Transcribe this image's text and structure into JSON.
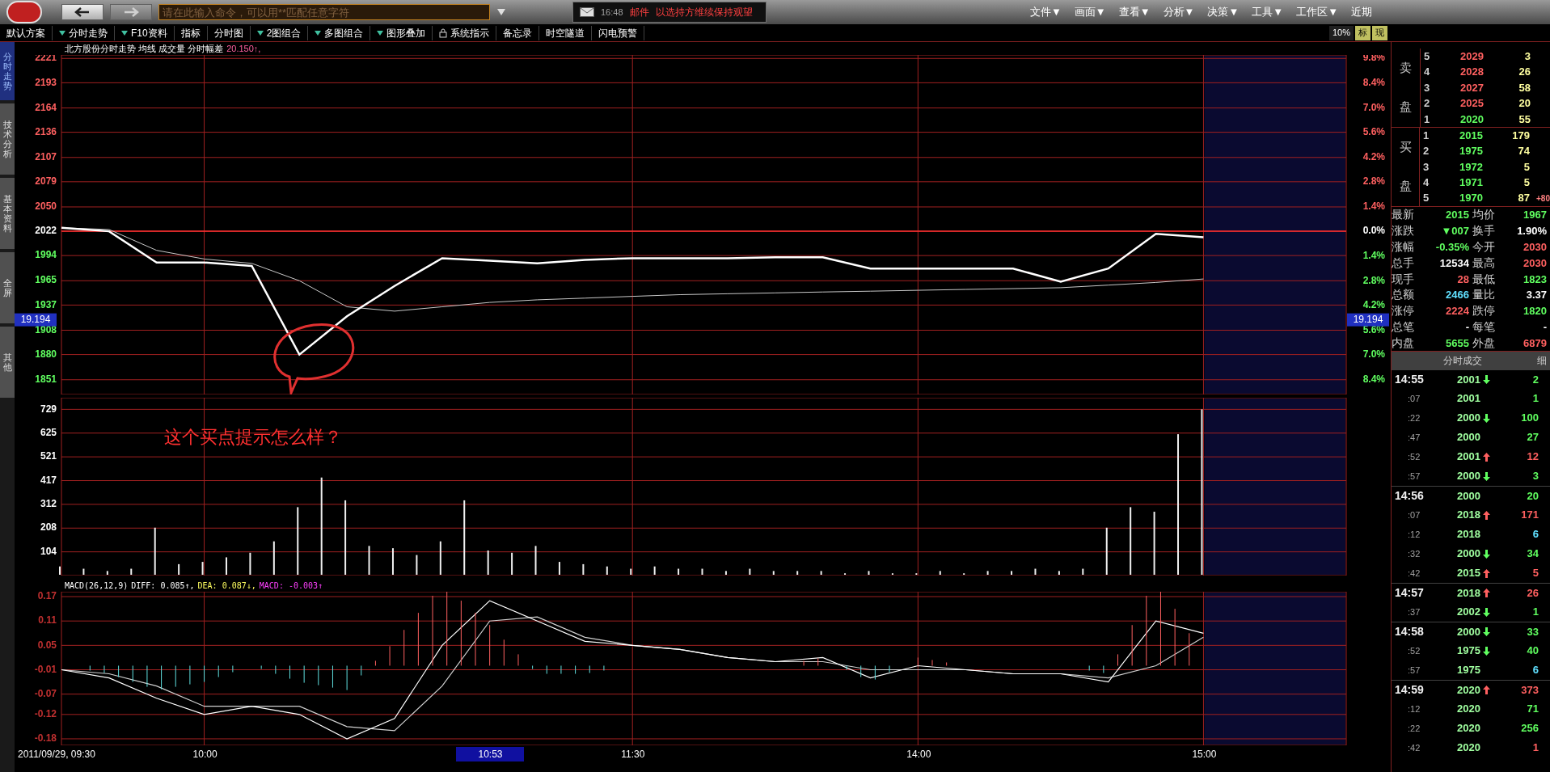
{
  "toolbar": {
    "command_placeholder": "请在此输入命令，可以用**匹配任意字符",
    "mail": {
      "time": "16:48",
      "label": "邮件",
      "message": "以选持方维续保持观望"
    },
    "menus": [
      "文件▼",
      "画面▼",
      "查看▼",
      "分析▼",
      "决策▼",
      "工具▼",
      "工作区▼",
      "近期"
    ]
  },
  "tabs": [
    {
      "label": "默认方案",
      "dropdown": false,
      "locked": false
    },
    {
      "label": "分时走势",
      "dropdown": true,
      "locked": false
    },
    {
      "label": "F10资料",
      "dropdown": true,
      "locked": false
    },
    {
      "label": "指标",
      "dropdown": false,
      "locked": false
    },
    {
      "label": "分时图",
      "dropdown": false,
      "locked": false
    },
    {
      "label": "2图组合",
      "dropdown": true,
      "locked": false
    },
    {
      "label": "多图组合",
      "dropdown": true,
      "locked": false
    },
    {
      "label": "图形叠加",
      "dropdown": true,
      "locked": false
    },
    {
      "label": "系统指示",
      "dropdown": false,
      "locked": true
    },
    {
      "label": "备忘录",
      "dropdown": false,
      "locked": false
    },
    {
      "label": "时空隧道",
      "dropdown": false,
      "locked": false
    },
    {
      "label": "闪电预警",
      "dropdown": false,
      "locked": false
    }
  ],
  "view_options": [
    {
      "label": "10%",
      "highlighted": false
    },
    {
      "label": "标",
      "highlighted": true
    },
    {
      "label": "现",
      "highlighted": true
    }
  ],
  "side_tabs": [
    {
      "label": "分时走势",
      "selected": true
    },
    {
      "label": "技术分析",
      "selected": false
    },
    {
      "label": "基本资料",
      "selected": false
    },
    {
      "label": "全屏",
      "selected": false
    },
    {
      "label": "其他",
      "selected": false
    }
  ],
  "price_chart": {
    "header": "北方股份分时走势 均线 成交量 分时幅差",
    "header_value": "20.150↑,",
    "chart_data": {
      "type": "line",
      "categories": [
        null,
        null,
        null,
        null,
        null,
        null,
        null,
        null,
        null,
        null,
        null,
        null,
        null,
        null,
        null,
        null,
        null,
        null,
        null,
        null,
        null,
        null,
        null,
        null,
        null
      ],
      "series": [
        {
          "color": "#ffffff",
          "values": [
            2026,
            2022,
            1986,
            1986,
            1982,
            1880,
            1924,
            1959,
            1991,
            1988,
            1985,
            1989,
            1991,
            1991,
            1991,
            1992,
            1992,
            1979,
            1979,
            1979,
            1979,
            1964,
            1979,
            2019,
            2015
          ]
        },
        {
          "color": "#c8c8c8",
          "values": [
            2026,
            2024,
            2000,
            1990,
            1985,
            1965,
            1935,
            1930,
            1935,
            1940,
            1943,
            1945,
            1947,
            1949,
            1950,
            1951,
            1952,
            1953,
            1954,
            1955,
            1956,
            1957,
            1960,
            1963,
            1967
          ]
        }
      ],
      "ylim": [
        1834,
        2225
      ],
      "yticks": [
        2221,
        2193,
        2164,
        2136,
        2107,
        2079,
        2050,
        2022,
        1994,
        1965,
        1937,
        1908,
        1880,
        1851
      ],
      "grid": true,
      "ref_lines": [
        {
          "axis": "y",
          "value": 2022
        }
      ],
      "annotations": [
        "19.194",
        "19.194"
      ]
    },
    "percent_labels": [
      {
        "label": "9.8%",
        "kind": "up"
      },
      {
        "label": "8.4%",
        "kind": "up"
      },
      {
        "label": "7.0%",
        "kind": "up"
      },
      {
        "label": "5.6%",
        "kind": "up"
      },
      {
        "label": "4.2%",
        "kind": "up"
      },
      {
        "label": "2.8%",
        "kind": "up"
      },
      {
        "label": "1.4%",
        "kind": "up"
      },
      {
        "label": "0.0%",
        "kind": "flat"
      },
      {
        "label": "1.4%",
        "kind": "down"
      },
      {
        "label": "2.8%",
        "kind": "down"
      },
      {
        "label": "4.2%",
        "kind": "down"
      },
      {
        "label": "5.6%",
        "kind": "down"
      },
      {
        "label": "7.0%",
        "kind": "down"
      },
      {
        "label": "8.4%",
        "kind": "down"
      }
    ]
  },
  "time_axis": [
    {
      "label": "2011/09/29, 09:30",
      "selected": false
    },
    {
      "label": "10:00",
      "selected": false
    },
    {
      "label": "10:53",
      "selected": true
    },
    {
      "label": "11:30",
      "selected": false
    },
    {
      "label": "14:00",
      "selected": false
    },
    {
      "label": "15:00",
      "selected": false
    }
  ],
  "volume_chart": {
    "axis_labels": [
      "729",
      "625",
      "521",
      "417",
      "312",
      "208",
      "104"
    ]
  },
  "annotation": {
    "text": "这个买点提示怎么样？"
  },
  "macd_chart": {
    "header": [
      {
        "text": "MACD(26,12,9)",
        "color": "#ffffff"
      },
      {
        "text": "DIFF: 0.085↑,",
        "color": "#ffffff"
      },
      {
        "text": "DEA: 0.087↓,",
        "color": "#ffff60"
      },
      {
        "text": "MACD: -0.003↑",
        "color": "#ff40ff"
      }
    ],
    "chart_data": {
      "type": "line",
      "categories": [
        null,
        null,
        null,
        null,
        null,
        null,
        null,
        null,
        null,
        null,
        null,
        null,
        null,
        null,
        null,
        null,
        null,
        null,
        null,
        null,
        null,
        null,
        null,
        null,
        null
      ],
      "series": [
        {
          "color": "#ffffff",
          "values": [
            -0.01,
            -0.03,
            -0.08,
            -0.12,
            -0.1,
            -0.12,
            -0.18,
            -0.13,
            0.05,
            0.16,
            0.11,
            0.06,
            0.05,
            0.04,
            0.02,
            0.01,
            0.02,
            -0.03,
            0,
            -0.01,
            -0.02,
            -0.02,
            -0.04,
            0.11,
            0.08
          ]
        },
        {
          "color": "#d0d0d0",
          "values": [
            -0.01,
            -0.02,
            -0.05,
            -0.1,
            -0.1,
            -0.1,
            -0.15,
            -0.16,
            -0.05,
            0.11,
            0.12,
            0.07,
            0.05,
            0.04,
            0.02,
            0.01,
            0.01,
            -0.01,
            -0.01,
            -0.01,
            -0.02,
            -0.02,
            -0.03,
            0,
            0.07
          ]
        }
      ],
      "ylim": [
        -0.196,
        0.182
      ],
      "yticks": [
        0.17,
        0.11,
        0.05,
        -0.01,
        -0.07,
        -0.12,
        -0.18
      ],
      "grid": true
    }
  },
  "order_book": {
    "sell": {
      "label_chars": [
        "卖",
        "盘"
      ],
      "rows": [
        {
          "level": "5",
          "price": "2029",
          "volume": "3",
          "color": "#ff6060"
        },
        {
          "level": "4",
          "price": "2028",
          "volume": "26",
          "color": "#ff6060"
        },
        {
          "level": "3",
          "price": "2027",
          "volume": "58",
          "color": "#ff6060"
        },
        {
          "level": "2",
          "price": "2025",
          "volume": "20",
          "color": "#ff6060"
        },
        {
          "level": "1",
          "price": "2020",
          "volume": "55",
          "color": "#60ff60"
        }
      ]
    },
    "buy": {
      "label_chars": [
        "买",
        "盘"
      ],
      "rows": [
        {
          "level": "1",
          "price": "2015",
          "volume": "179",
          "color": "#60ff60"
        },
        {
          "level": "2",
          "price": "1975",
          "volume": "74",
          "color": "#60ff60"
        },
        {
          "level": "3",
          "price": "1972",
          "volume": "5",
          "color": "#60ff60"
        },
        {
          "level": "4",
          "price": "1971",
          "volume": "5",
          "color": "#60ff60"
        },
        {
          "level": "5",
          "price": "1970",
          "volume": "87",
          "color": "#60ff60",
          "change": "+80"
        }
      ]
    }
  },
  "quote": [
    {
      "left": {
        "label": "最新",
        "value": "2015",
        "color": "#60ff60"
      },
      "right": {
        "label": "均价",
        "value": "1967",
        "color": "#60ff60"
      }
    },
    {
      "left": {
        "label": "涨跌",
        "value": "▼007",
        "color": "#60ff60"
      },
      "right": {
        "label": "换手",
        "value": "1.90%",
        "color": "#ffffff"
      }
    },
    {
      "left": {
        "label": "涨幅",
        "value": "-0.35%",
        "color": "#60ff60"
      },
      "right": {
        "label": "今开",
        "value": "2030",
        "color": "#ff6060"
      }
    },
    {
      "left": {
        "label": "总手",
        "value": "12534",
        "color": "#ffffff"
      },
      "right": {
        "label": "最高",
        "value": "2030",
        "color": "#ff6060"
      }
    },
    {
      "left": {
        "label": "现手",
        "value": "28",
        "color": "#ff6060"
      },
      "right": {
        "label": "最低",
        "value": "1823",
        "color": "#60ff60"
      }
    },
    {
      "left": {
        "label": "总额",
        "value": "2466",
        "color": "#60e0ff"
      },
      "right": {
        "label": "量比",
        "value": "3.37",
        "color": "#ffffff"
      }
    },
    {
      "left": {
        "label": "涨停",
        "value": "2224",
        "color": "#ff6060"
      },
      "right": {
        "label": "跌停",
        "value": "1820",
        "color": "#60ff60"
      }
    },
    {
      "left": {
        "label": "总笔",
        "value": "-"
      },
      "right": {
        "label": "每笔",
        "value": "-"
      }
    },
    {
      "left": {
        "label": "内盘",
        "value": "5655",
        "color": "#60ff60"
      },
      "right": {
        "label": "外盘",
        "value": "6879",
        "color": "#ff6060"
      }
    }
  ],
  "trades": {
    "title": "分时成交",
    "detail_tab": "细",
    "rows": [
      {
        "time": "14:55",
        "kind": "minute",
        "price": "2001",
        "uptick": false,
        "downtick": true,
        "volume": "2",
        "color": "#60ff60"
      },
      {
        "time": ":07",
        "kind": "second",
        "price": "2001",
        "uptick": false,
        "downtick": false,
        "volume": "1",
        "color": "#60ff60"
      },
      {
        "time": ":22",
        "kind": "second",
        "price": "2000",
        "uptick": false,
        "downtick": true,
        "volume": "100",
        "color": "#60ff60"
      },
      {
        "time": ":47",
        "kind": "second",
        "price": "2000",
        "uptick": false,
        "downtick": false,
        "volume": "27",
        "color": "#60ff60"
      },
      {
        "time": ":52",
        "kind": "second",
        "price": "2001",
        "uptick": true,
        "downtick": false,
        "volume": "12",
        "color": "#ff6060"
      },
      {
        "time": ":57",
        "kind": "second",
        "price": "2000",
        "uptick": false,
        "downtick": true,
        "volume": "3",
        "color": "#60ff60"
      },
      {
        "time": "14:56",
        "kind": "minute",
        "price": "2000",
        "uptick": false,
        "downtick": false,
        "volume": "20",
        "color": "#60ff60"
      },
      {
        "time": ":07",
        "kind": "second",
        "price": "2018",
        "uptick": true,
        "downtick": false,
        "volume": "171",
        "color": "#ff6060"
      },
      {
        "time": ":12",
        "kind": "second",
        "price": "2018",
        "uptick": false,
        "downtick": false,
        "volume": "6",
        "color": "#60e0ff"
      },
      {
        "time": ":32",
        "kind": "second",
        "price": "2000",
        "uptick": false,
        "downtick": true,
        "volume": "34",
        "color": "#60ff60"
      },
      {
        "time": ":42",
        "kind": "second",
        "price": "2015",
        "uptick": true,
        "downtick": false,
        "volume": "5",
        "color": "#ff6060"
      },
      {
        "time": "14:57",
        "kind": "minute",
        "price": "2018",
        "uptick": true,
        "downtick": false,
        "volume": "26",
        "color": "#ff6060"
      },
      {
        "time": ":37",
        "kind": "second",
        "price": "2002",
        "uptick": false,
        "downtick": true,
        "volume": "1",
        "color": "#60ff60"
      },
      {
        "time": "14:58",
        "kind": "minute",
        "price": "2000",
        "uptick": false,
        "downtick": true,
        "volume": "33",
        "color": "#60ff60"
      },
      {
        "time": ":52",
        "kind": "second",
        "price": "1975",
        "uptick": false,
        "downtick": true,
        "volume": "40",
        "color": "#60ff60"
      },
      {
        "time": ":57",
        "kind": "second",
        "price": "1975",
        "uptick": false,
        "downtick": false,
        "volume": "6",
        "color": "#60e0ff"
      },
      {
        "time": "14:59",
        "kind": "minute",
        "price": "2020",
        "uptick": true,
        "downtick": false,
        "volume": "373",
        "color": "#ff6060"
      },
      {
        "time": ":12",
        "kind": "second",
        "price": "2020",
        "uptick": false,
        "downtick": false,
        "volume": "71",
        "color": "#60ff60"
      },
      {
        "time": ":22",
        "kind": "second",
        "price": "2020",
        "uptick": false,
        "downtick": false,
        "volume": "256",
        "color": "#60ff60"
      },
      {
        "time": ":42",
        "kind": "second",
        "price": "2020",
        "uptick": false,
        "downtick": false,
        "volume": "1",
        "color": "#ff6060"
      }
    ]
  }
}
